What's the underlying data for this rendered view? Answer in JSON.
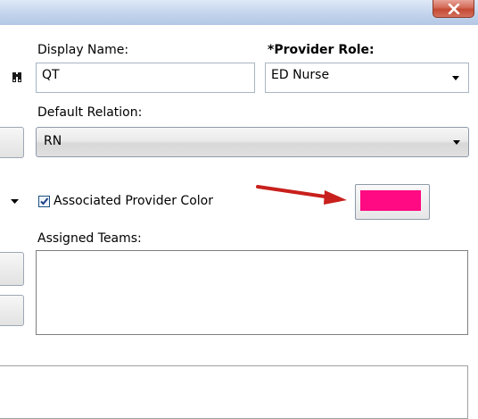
{
  "window": {
    "close_button": "close"
  },
  "form": {
    "display_name_label": "Display Name:",
    "display_name_value": "QT",
    "provider_role_label": "*Provider Role:",
    "provider_role_value": "ED Nurse",
    "default_relation_label": "Default Relation:",
    "default_relation_value": "RN",
    "associated_color_label": "Associated Provider Color",
    "associated_color_checked": true,
    "associated_color_value": "#ff0a82",
    "assigned_teams_label": "Assigned Teams:",
    "assigned_teams_items": []
  },
  "annotation": {
    "arrow_color": "#c8201c"
  },
  "icons": {
    "lookup": "binoculars-icon",
    "dropdown": "chevron-down-icon",
    "close": "close-icon",
    "check": "check-icon"
  }
}
